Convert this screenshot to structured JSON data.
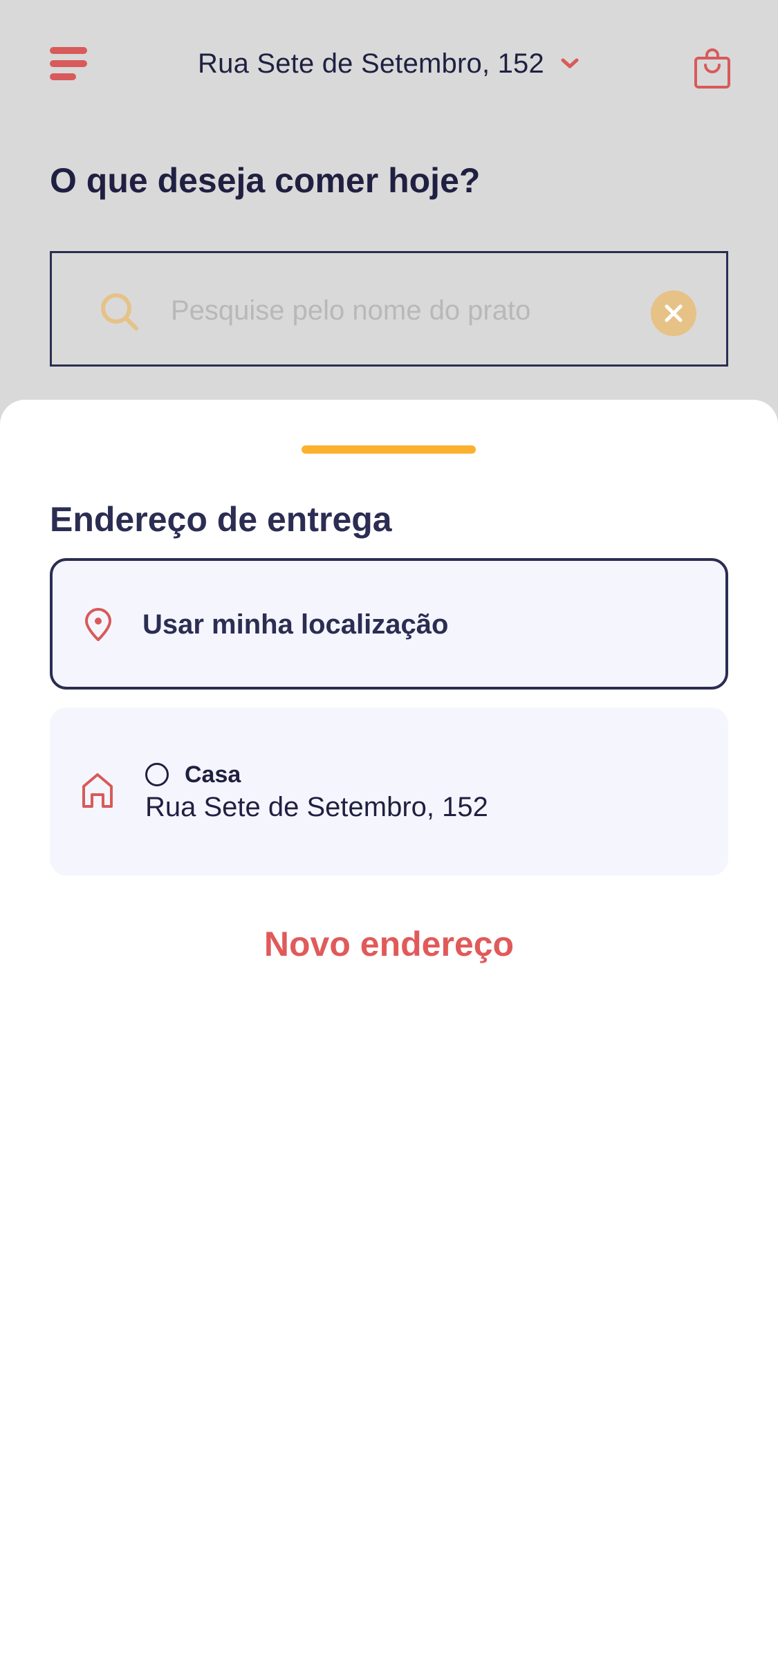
{
  "header": {
    "current_address": "Rua Sete de Setembro, 152",
    "menu_icon": "hamburger-icon",
    "dropdown_icon": "chevron-down-icon",
    "bag_icon": "shopping-bag-icon"
  },
  "home": {
    "title": "O que deseja comer hoje?",
    "search": {
      "value": "",
      "placeholder": "Pesquise pelo nome do prato",
      "search_icon": "search-icon",
      "clear_icon": "close-icon"
    }
  },
  "sheet": {
    "title": "Endereço de entrega",
    "use_location": {
      "label": "Usar minha localização",
      "icon": "map-pin-icon"
    },
    "saved_addresses": [
      {
        "name": "Casa",
        "street": "Rua Sete de Setembro, 152",
        "icon": "home-icon",
        "selected": false
      }
    ],
    "new_address_label": "Novo endereço"
  },
  "colors": {
    "accent_red": "#d85a5a",
    "handle_yellow": "#fbb12f",
    "navy": "#2b2d52",
    "card_bg": "#f5f6fd",
    "overlay_bg": "#d9d9d9",
    "search_icon_tan": "#e6c287"
  }
}
